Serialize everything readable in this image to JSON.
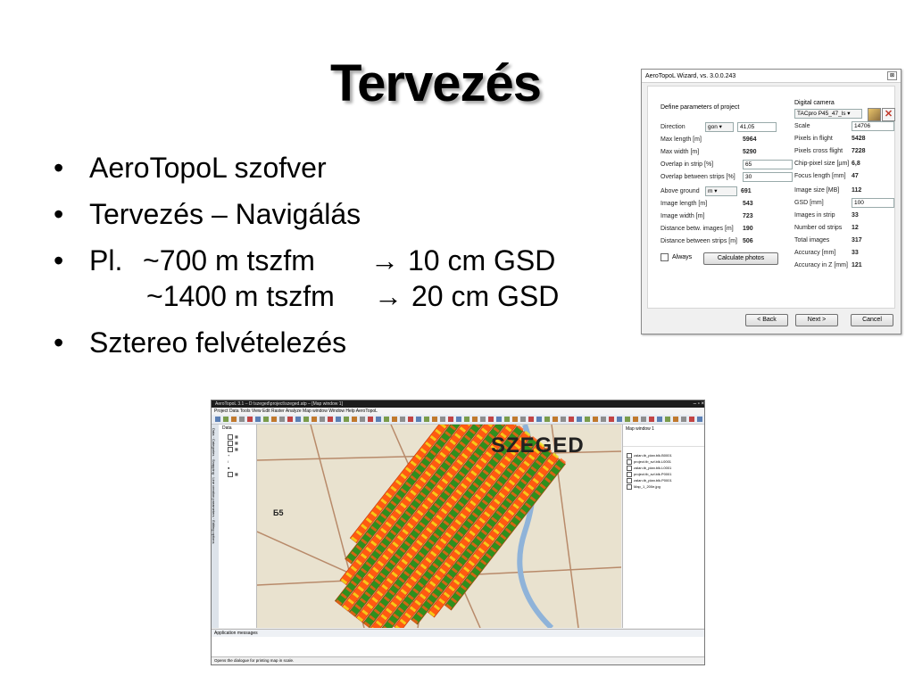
{
  "slide": {
    "title": "Tervezés",
    "bullets": [
      "AeroTopoL szofver",
      "Tervezés – Navigálás",
      "Sztereo felvételezés"
    ],
    "bullet_symbol": "•",
    "gsd": {
      "prefix": "Pl.",
      "arrow": "→",
      "rows": [
        {
          "condition": "~700 m tszfm",
          "result": "10 cm GSD"
        },
        {
          "condition": "~1400 m tszfm",
          "result": "20 cm GSD"
        }
      ]
    }
  },
  "wizard": {
    "title": "AeroTopoL Wizard, vs. 3.0.0.243",
    "close_symbol": "⊠",
    "left_heading": "Define parameters of project",
    "direction": {
      "label": "Direction",
      "unit": "gon",
      "value": "41,05"
    },
    "max_length": {
      "label": "Max length [m]",
      "value": "5964"
    },
    "max_width": {
      "label": "Max width [m]",
      "value": "5290"
    },
    "overlap_strip": {
      "label": "Overlap in strip [%]",
      "value": "65"
    },
    "overlap_between": {
      "label": "Overlap between strips [%]",
      "value": "30"
    },
    "above_ground": {
      "label": "Above ground",
      "unit": "m",
      "value": "691"
    },
    "image_length": {
      "label": "Image length [m]",
      "value": "543"
    },
    "image_width": {
      "label": "Image width [m]",
      "value": "723"
    },
    "dist_images": {
      "label": "Distance betw. images [m]",
      "value": "190"
    },
    "dist_strips": {
      "label": "Distance between strips [m]",
      "value": "506"
    },
    "always_label": "Always",
    "calc_button": "Calculate photos",
    "right_heading": "Digital camera",
    "camera_value": "TACpro P45_47_ls",
    "scale": {
      "label": "Scale",
      "value": "14706"
    },
    "pixels_flight": {
      "label": "Pixels in flight",
      "value": "5428"
    },
    "pixels_cross": {
      "label": "Pixels cross flight",
      "value": "7228"
    },
    "chip_pixel": {
      "label": "Chip-pixel size [µm]",
      "value": "6,8"
    },
    "focus_length": {
      "label": "Focus length [mm]",
      "value": "47"
    },
    "image_size": {
      "label": "Image size [MB]",
      "value": "112"
    },
    "gsd": {
      "label": "GSD [mm]",
      "value": "100"
    },
    "images_strip": {
      "label": "Images in  strip",
      "value": "33"
    },
    "num_strips": {
      "label": "Number od strips",
      "value": "12"
    },
    "total_images": {
      "label": "Total images",
      "value": "317"
    },
    "accuracy": {
      "label": "Accuracy [mm]",
      "value": "33"
    },
    "accuracy_z": {
      "label": "Accuracy in Z [mm]",
      "value": "121"
    },
    "back_button": "< Back",
    "next_button": "Next >",
    "cancel_button": "Cancel"
  },
  "gis": {
    "window_title": "AeroTopoL 3.1 – D:\\szeged\\project\\szeged.atp – [Map window 1]",
    "window_buttons": "– ▫ ×",
    "menu": "Project   Data   Tools   View   Edit   Raster   Analyze   Map window   Window   Help   AeroTopoL",
    "left_panel_title": "Data",
    "left_tabs": [
      "Data",
      "Categories",
      "Snapping",
      "Line creation parameters",
      "Editing options"
    ],
    "map_label": "SZEGED",
    "map_number": "Б5",
    "map_window_title": "Map window 1",
    "layers": [
      "zalan.tb_plan.blk.B0001",
      "project.tb_svl.blk.L0001",
      "zalan.tb_plan.blk.L0001",
      "project.tb_svl.blk.P0001",
      "zalan.tb_plan.blk.P0001",
      "Map_1_200e.jpg"
    ],
    "messages_title": "Application messages",
    "status_text": "Opens the dialogue for printing map in scale.",
    "colors": {
      "strip_orange": "#ff5a12",
      "strip_green": "#2f8f1e",
      "marker_yellow": "#f2e51a",
      "map_bg": "#e9e2cf",
      "river_blue": "#8fb3d9"
    }
  }
}
